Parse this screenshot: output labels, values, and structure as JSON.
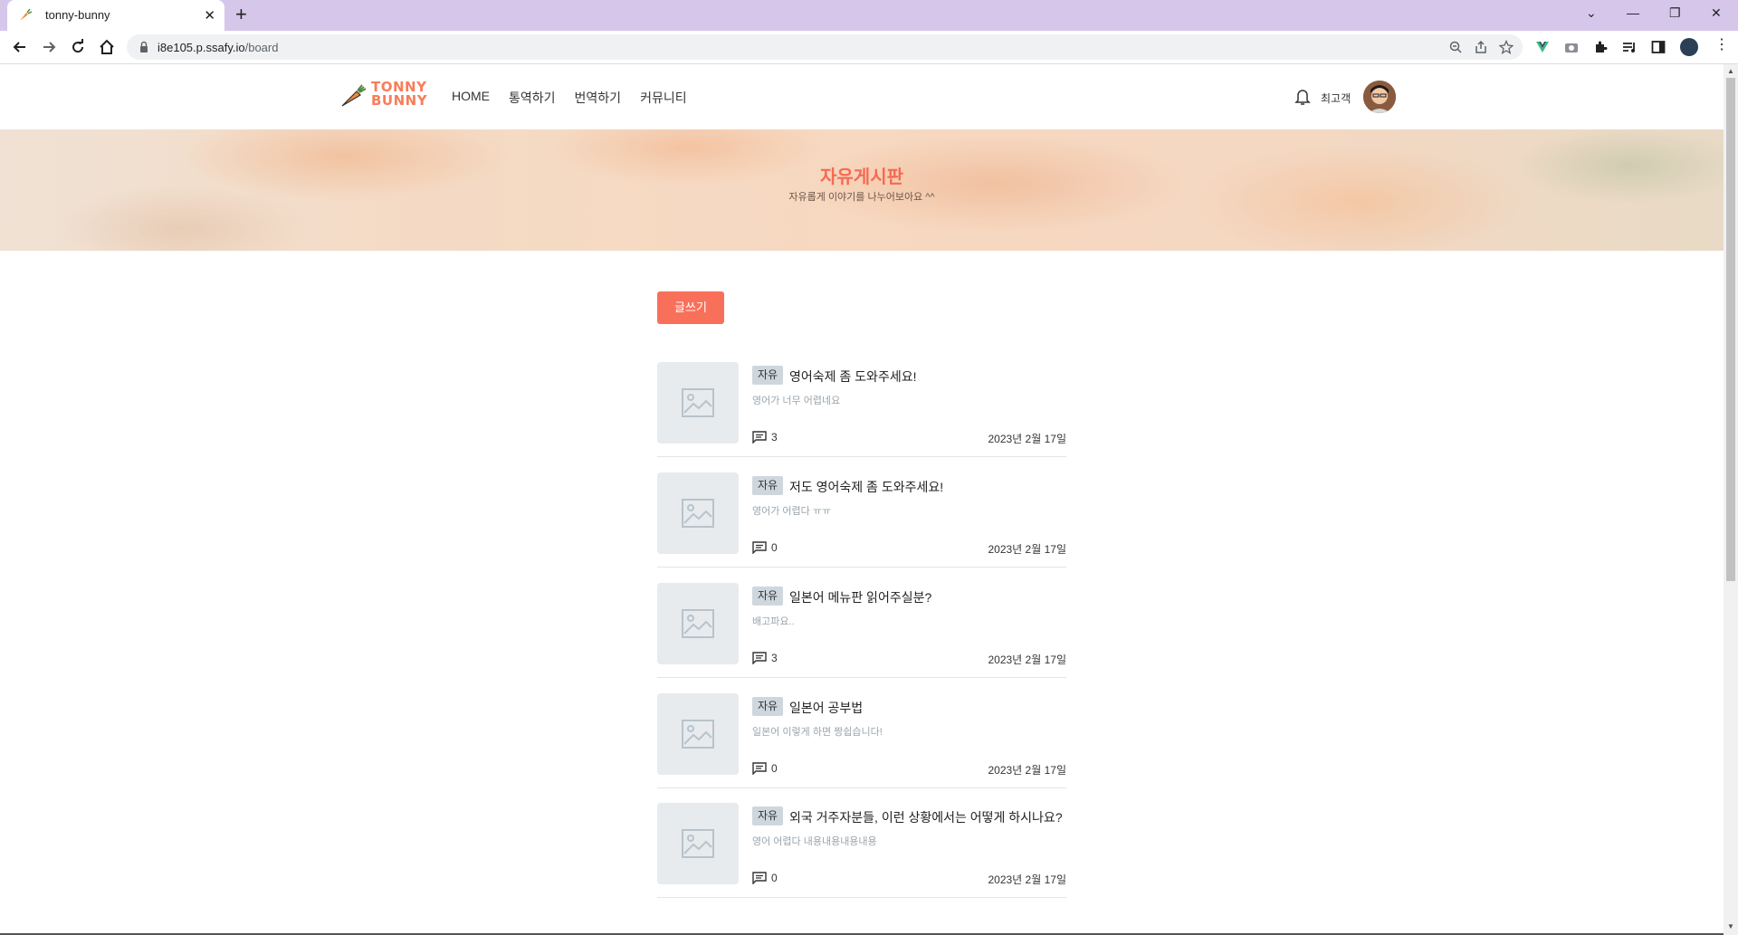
{
  "browser": {
    "tab_title": "tonny-bunny",
    "tab_close": "✕",
    "new_tab": "+",
    "url_host": "i8e105.p.ssafy.io",
    "url_path": "/board",
    "window_controls": [
      "⌄",
      "—",
      "❐",
      "✕"
    ]
  },
  "site": {
    "logo_line1": "TONNY",
    "logo_line2": "BUNNY",
    "nav": [
      "HOME",
      "통역하기",
      "번역하기",
      "커뮤니티"
    ],
    "username": "최고객"
  },
  "banner": {
    "title": "자유게시판",
    "subtitle": "자유롭게 이야기를 나누어보아요 ^^"
  },
  "write_button": "글쓰기",
  "posts": [
    {
      "tag": "자유",
      "title": "영어숙제 좀 도와주세요!",
      "desc": "영어가 너무 어렵네요",
      "comments": "3",
      "date": "2023년 2월 17일"
    },
    {
      "tag": "자유",
      "title": "저도 영어숙제 좀 도와주세요!",
      "desc": "영어가 어렵다 ㅠㅠ",
      "comments": "0",
      "date": "2023년 2월 17일"
    },
    {
      "tag": "자유",
      "title": "일본어 메뉴판 읽어주실분?",
      "desc": "배고파요..",
      "comments": "3",
      "date": "2023년 2월 17일"
    },
    {
      "tag": "자유",
      "title": "일본어 공부법",
      "desc": "일본어 이렇게 하면 짱쉽습니다!",
      "comments": "0",
      "date": "2023년 2월 17일"
    },
    {
      "tag": "자유",
      "title": "외국 거주자분들, 이런 상황에서는 어떻게 하시나요?",
      "desc": "영어 어렵다 내용내용내용내용",
      "comments": "0",
      "date": "2023년 2월 17일"
    }
  ],
  "colors": {
    "accent": "#f8705a",
    "browser_frame": "#d5c6ea",
    "badge_bg": "#cfd7de"
  },
  "icons": {
    "tab_favicon": "carrot-icon",
    "back": "arrow-left-icon",
    "forward": "arrow-right-icon",
    "reload": "reload-icon",
    "home": "home-icon",
    "lock": "lock-icon",
    "zoom": "zoom-icon",
    "share": "share-icon",
    "bookmark": "star-icon",
    "notifications": "bell-icon",
    "comments": "comment-icon",
    "thumbnail": "image-placeholder-icon"
  }
}
